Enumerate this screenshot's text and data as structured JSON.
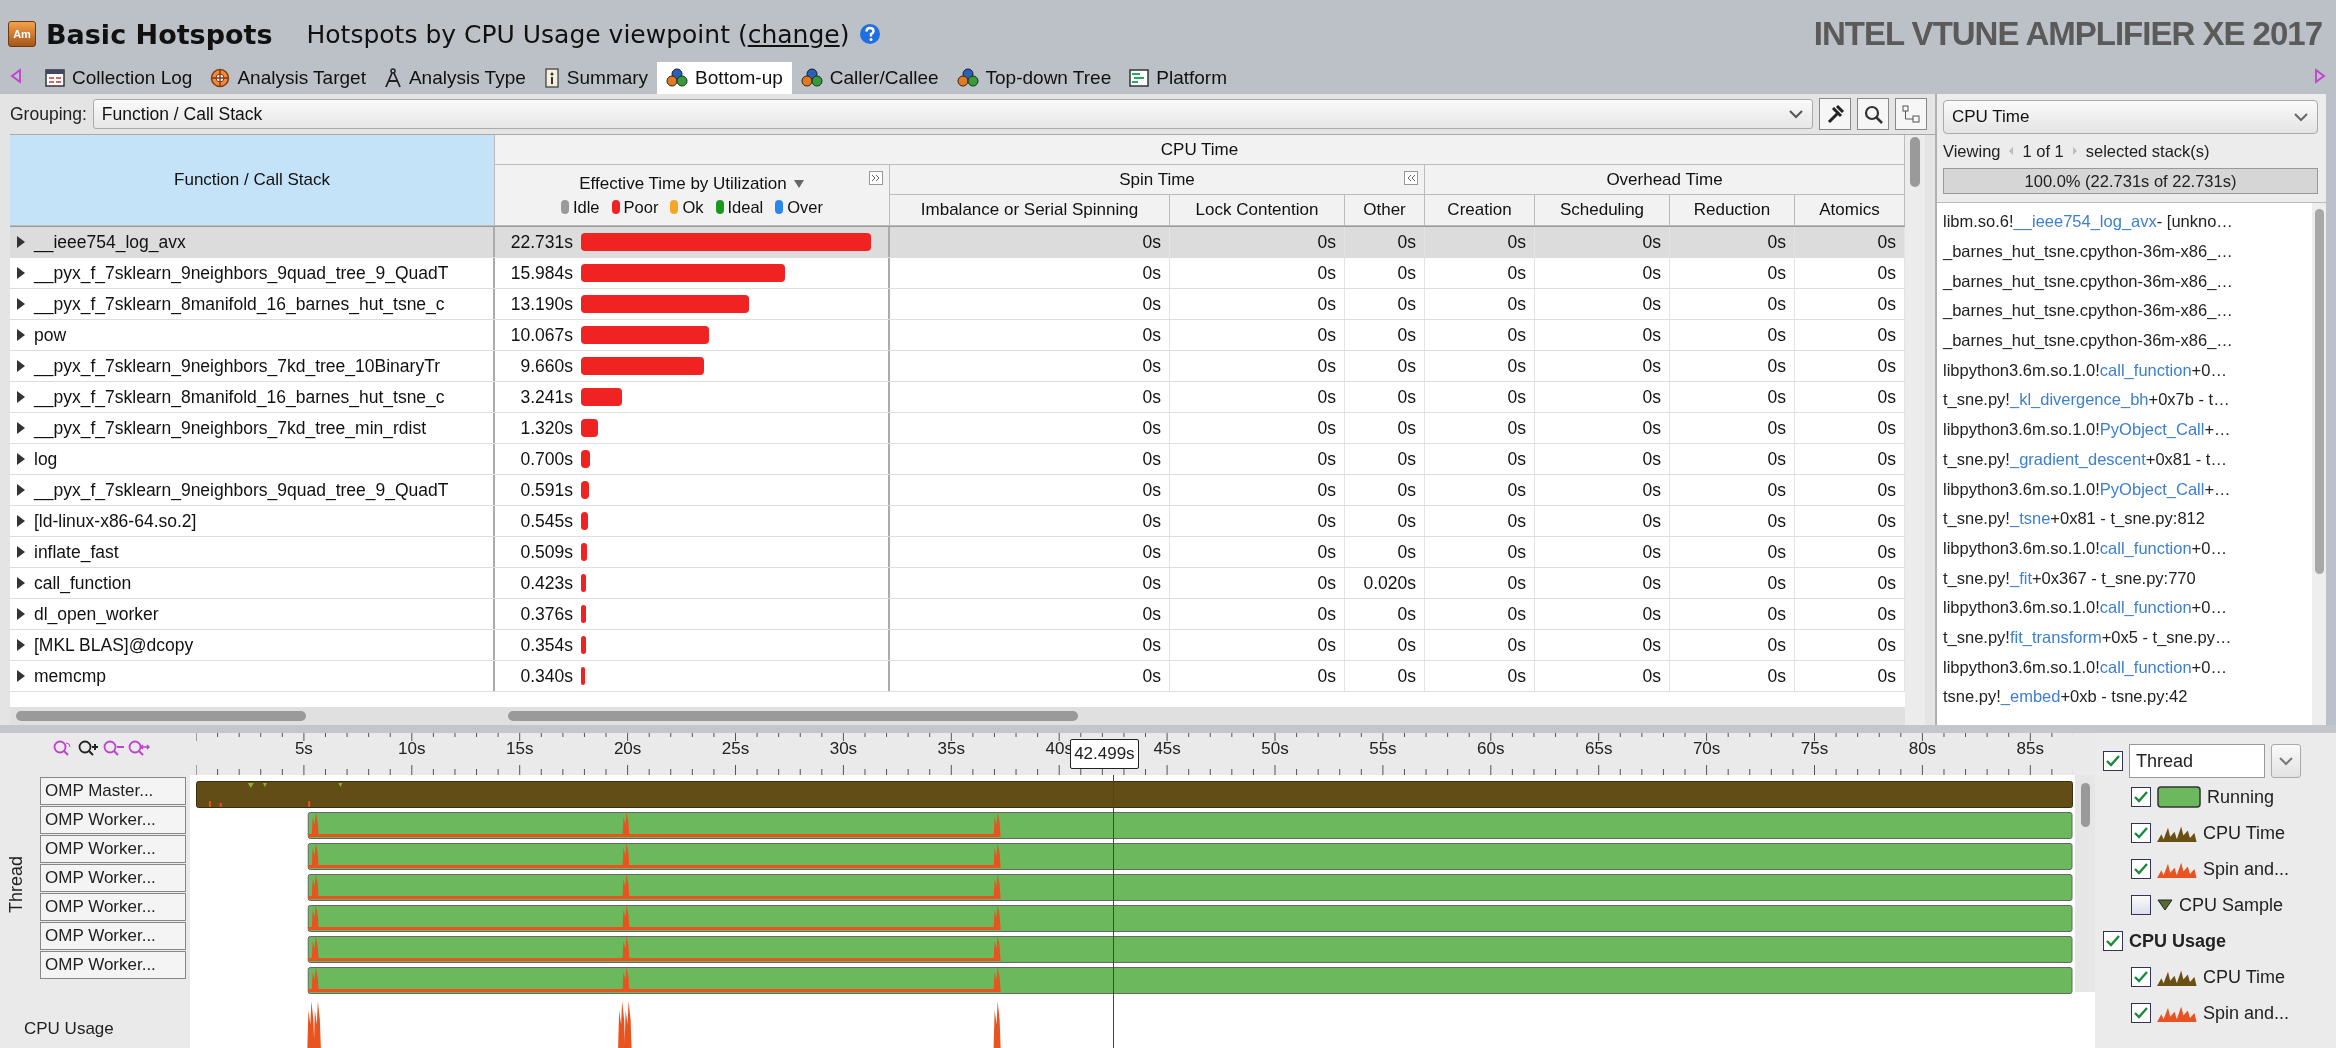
{
  "app": {
    "logo_text": "Am",
    "title": "Basic Hotspots",
    "viewpoint": "Hotspots by CPU Usage viewpoint (",
    "change_link": "change",
    "viewpoint_end": ")",
    "brand": "INTEL VTUNE AMPLIFIER XE 2017"
  },
  "tabs": [
    {
      "label": "Collection Log",
      "selected": false
    },
    {
      "label": "Analysis Target",
      "selected": false
    },
    {
      "label": "Analysis Type",
      "selected": false
    },
    {
      "label": "Summary",
      "selected": false
    },
    {
      "label": "Bottom-up",
      "selected": true
    },
    {
      "label": "Caller/Callee",
      "selected": false
    },
    {
      "label": "Top-down Tree",
      "selected": false
    },
    {
      "label": "Platform",
      "selected": false
    }
  ],
  "grouping": {
    "label": "Grouping:",
    "value": "Function / Call Stack"
  },
  "grid": {
    "function_header": "Function / Call Stack",
    "cpu_time_header": "CPU Time",
    "effective_header": "Effective Time by Utilization",
    "spin_header": "Spin Time",
    "overhead_header": "Overhead Time",
    "utilization_legend": [
      {
        "label": "Idle",
        "color": "#9b9b9b"
      },
      {
        "label": "Poor",
        "color": "#ee2222"
      },
      {
        "label": "Ok",
        "color": "#f5a623"
      },
      {
        "label": "Ideal",
        "color": "#1a9a1a"
      },
      {
        "label": "Over",
        "color": "#2a86f0"
      }
    ],
    "columns": [
      "Imbalance or Serial Spinning",
      "Lock Contention",
      "Other",
      "Creation",
      "Scheduling",
      "Reduction",
      "Atomics"
    ],
    "rows": [
      {
        "name": "__ieee754_log_avx",
        "time": "22.731s",
        "values": [
          "0s",
          "0s",
          "0s",
          "0s",
          "0s",
          "0s",
          "0s"
        ],
        "selected": true
      },
      {
        "name": "__pyx_f_7sklearn_9neighbors_9quad_tree_9_QuadT",
        "time": "15.984s",
        "values": [
          "0s",
          "0s",
          "0s",
          "0s",
          "0s",
          "0s",
          "0s"
        ],
        "selected": false
      },
      {
        "name": "__pyx_f_7sklearn_8manifold_16_barnes_hut_tsne_c",
        "time": "13.190s",
        "values": [
          "0s",
          "0s",
          "0s",
          "0s",
          "0s",
          "0s",
          "0s"
        ],
        "selected": false
      },
      {
        "name": "pow",
        "time": "10.067s",
        "values": [
          "0s",
          "0s",
          "0s",
          "0s",
          "0s",
          "0s",
          "0s"
        ],
        "selected": false
      },
      {
        "name": "__pyx_f_7sklearn_9neighbors_7kd_tree_10BinaryTr",
        "time": "9.660s",
        "values": [
          "0s",
          "0s",
          "0s",
          "0s",
          "0s",
          "0s",
          "0s"
        ],
        "selected": false
      },
      {
        "name": "__pyx_f_7sklearn_8manifold_16_barnes_hut_tsne_c",
        "time": "3.241s",
        "values": [
          "0s",
          "0s",
          "0s",
          "0s",
          "0s",
          "0s",
          "0s"
        ],
        "selected": false
      },
      {
        "name": "__pyx_f_7sklearn_9neighbors_7kd_tree_min_rdist",
        "time": "1.320s",
        "values": [
          "0s",
          "0s",
          "0s",
          "0s",
          "0s",
          "0s",
          "0s"
        ],
        "selected": false
      },
      {
        "name": "log",
        "time": "0.700s",
        "values": [
          "0s",
          "0s",
          "0s",
          "0s",
          "0s",
          "0s",
          "0s"
        ],
        "selected": false
      },
      {
        "name": "__pyx_f_7sklearn_9neighbors_9quad_tree_9_QuadT",
        "time": "0.591s",
        "values": [
          "0s",
          "0s",
          "0s",
          "0s",
          "0s",
          "0s",
          "0s"
        ],
        "selected": false
      },
      {
        "name": "[ld-linux-x86-64.so.2]",
        "time": "0.545s",
        "values": [
          "0s",
          "0s",
          "0s",
          "0s",
          "0s",
          "0s",
          "0s"
        ],
        "selected": false
      },
      {
        "name": "inflate_fast",
        "time": "0.509s",
        "values": [
          "0s",
          "0s",
          "0s",
          "0s",
          "0s",
          "0s",
          "0s"
        ],
        "selected": false
      },
      {
        "name": "call_function",
        "time": "0.423s",
        "values": [
          "0s",
          "0s",
          "0.020s",
          "0s",
          "0s",
          "0s",
          "0s"
        ],
        "selected": false
      },
      {
        "name": "dl_open_worker",
        "time": "0.376s",
        "values": [
          "0s",
          "0s",
          "0s",
          "0s",
          "0s",
          "0s",
          "0s"
        ],
        "selected": false
      },
      {
        "name": "[MKL BLAS]@dcopy",
        "time": "0.354s",
        "values": [
          "0s",
          "0s",
          "0s",
          "0s",
          "0s",
          "0s",
          "0s"
        ],
        "selected": false
      },
      {
        "name": "memcmp",
        "time": "0.340s",
        "values": [
          "0s",
          "0s",
          "0s",
          "0s",
          "0s",
          "0s",
          "0s"
        ],
        "selected": false
      }
    ]
  },
  "stack_pane": {
    "metric": "CPU Time",
    "viewing": "Viewing",
    "position": "1 of 1",
    "suffix": "selected stack(s)",
    "summary": "100.0% (22.731s of 22.731s)",
    "frames": [
      {
        "module": "libm.so.6!",
        "function": "__ieee754_log_avx",
        "rest": " - [unkno…"
      },
      {
        "module": "_barnes_hut_tsne.cpython-36m-x86_…"
      },
      {
        "module": "_barnes_hut_tsne.cpython-36m-x86_…"
      },
      {
        "module": "_barnes_hut_tsne.cpython-36m-x86_…"
      },
      {
        "module": "_barnes_hut_tsne.cpython-36m-x86_…"
      },
      {
        "module": "libpython3.6m.so.1.0!",
        "function": "call_function",
        "rest": "+0…"
      },
      {
        "module": "t_sne.py!",
        "function": "_kl_divergence_bh",
        "rest": "+0x7b - t…"
      },
      {
        "module": "libpython3.6m.so.1.0!",
        "function": "PyObject_Call",
        "rest": "+…"
      },
      {
        "module": "t_sne.py!",
        "function": "_gradient_descent",
        "rest": "+0x81 - t…"
      },
      {
        "module": "libpython3.6m.so.1.0!",
        "function": "PyObject_Call",
        "rest": "+…"
      },
      {
        "module": "t_sne.py!",
        "function": "_tsne",
        "rest": "+0x81 - t_sne.py:812"
      },
      {
        "module": "libpython3.6m.so.1.0!",
        "function": "call_function",
        "rest": "+0…"
      },
      {
        "module": "t_sne.py!",
        "function": "_fit",
        "rest": "+0x367 - t_sne.py:770"
      },
      {
        "module": "libpython3.6m.so.1.0!",
        "function": "call_function",
        "rest": "+0…"
      },
      {
        "module": "t_sne.py!",
        "function": "fit_transform",
        "rest": "+0x5 - t_sne.py…"
      },
      {
        "module": "libpython3.6m.so.1.0!",
        "function": "call_function",
        "rest": "+0…"
      },
      {
        "module": "tsne.py!",
        "function": "_embed",
        "rest": "+0xb - tsne.py:42"
      }
    ]
  },
  "timeline": {
    "ticks": [
      "5s",
      "10s",
      "15s",
      "20s",
      "25s",
      "30s",
      "35s",
      "40s",
      "45s",
      "50s",
      "55s",
      "60s",
      "65s",
      "70s",
      "75s",
      "80s",
      "85s"
    ],
    "cursor": "42.499s",
    "axis_label": "Thread",
    "usage_label": "CPU Usage",
    "threads": [
      {
        "label": "OMP Master...",
        "kind": "master"
      },
      {
        "label": "OMP Worker...",
        "kind": "worker"
      },
      {
        "label": "OMP Worker...",
        "kind": "worker"
      },
      {
        "label": "OMP Worker...",
        "kind": "worker"
      },
      {
        "label": "OMP Worker...",
        "kind": "worker"
      },
      {
        "label": "OMP Worker...",
        "kind": "worker"
      },
      {
        "label": "OMP Worker...",
        "kind": "worker"
      }
    ]
  },
  "legend": {
    "mode": "Thread",
    "mode_checked": true,
    "items": [
      {
        "label": "Running",
        "kind": "running",
        "checked": true
      },
      {
        "label": "CPU Time",
        "kind": "cpu",
        "checked": true
      },
      {
        "label": "Spin and...",
        "kind": "spin",
        "checked": true
      },
      {
        "label": "CPU Sample",
        "kind": "sample",
        "checked": false
      },
      {
        "label": "CPU Usage",
        "kind": "group",
        "checked": true
      },
      {
        "label": "CPU Time",
        "kind": "cpu",
        "checked": true
      },
      {
        "label": "Spin and...",
        "kind": "spin",
        "checked": true
      }
    ]
  }
}
